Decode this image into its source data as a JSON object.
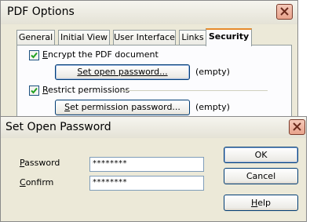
{
  "pdf_options": {
    "title": "PDF Options",
    "tabs": [
      {
        "label": "General"
      },
      {
        "label": "Initial View"
      },
      {
        "label": "User Interface"
      },
      {
        "label": "Links"
      },
      {
        "label": "Security",
        "active": true
      }
    ],
    "encrypt_label": "Encrypt the PDF document",
    "encrypt_checked": true,
    "set_open_password_button": "Set open password...",
    "open_password_status": "(empty)",
    "restrict_label": "Restrict permissions",
    "restrict_checked": true,
    "set_permission_password_button": "Set permission password...",
    "permission_password_status": "(empty)"
  },
  "set_open_password": {
    "title": "Set Open Password",
    "password_label": "Password",
    "password_value": "********",
    "confirm_label": "Confirm",
    "confirm_value": "********",
    "ok_button": "OK",
    "cancel_button": "Cancel",
    "help_button": "Help"
  },
  "colors": {
    "dialog_bg": "#ece9d8",
    "panel_bg": "#fcfcfe",
    "close_button": "#e8a38c",
    "active_tab_accent": "#e68b2c"
  },
  "icons": [
    "close-icon",
    "checkmark-icon"
  ]
}
